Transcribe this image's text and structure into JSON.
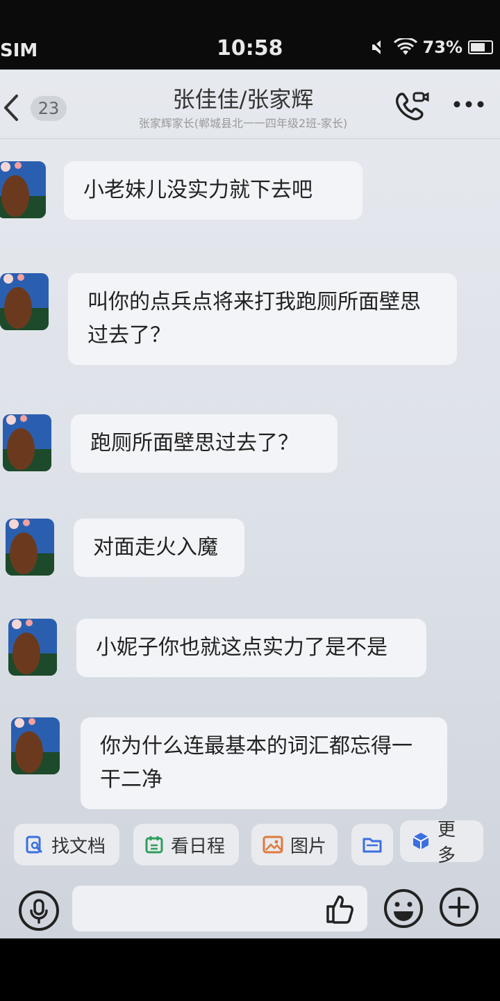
{
  "status_bar": {
    "carrier": "SIM",
    "time": "10:58",
    "battery": "73%",
    "battery_level": 0.73
  },
  "header": {
    "unread_count": "23",
    "title": "张佳佳/张家辉",
    "subtitle": "张家辉家长(郸城县北一一四年级2班-家长)"
  },
  "messages": [
    {
      "text": "小老妹儿没实力就下去吧"
    },
    {
      "text": "叫你的点兵点将来打我跑厕所面壁思过去了？"
    },
    {
      "text": "跑厕所面壁思过去了？"
    },
    {
      "text": "对面走火入魔"
    },
    {
      "text": "小妮子你也就这点实力了是不是"
    },
    {
      "text": "你为什么连最基本的词汇都忘得一干二净"
    }
  ],
  "quick_actions": [
    {
      "label": "找文档",
      "icon": "doc-search-icon",
      "color": "#3b6fe0"
    },
    {
      "label": "看日程",
      "icon": "calendar-icon",
      "color": "#2e9e5b"
    },
    {
      "label": "图片",
      "icon": "image-icon",
      "color": "#e07a3b"
    },
    {
      "label": "",
      "icon": "folder-icon",
      "color": "#3b6fe0"
    },
    {
      "label": "更多",
      "icon": "cube-icon",
      "color": "#3b6fe0"
    }
  ],
  "colors": {
    "accent": "#3b6fe0",
    "background": "#e3e6eb",
    "bubble": "#f3f4f7"
  }
}
